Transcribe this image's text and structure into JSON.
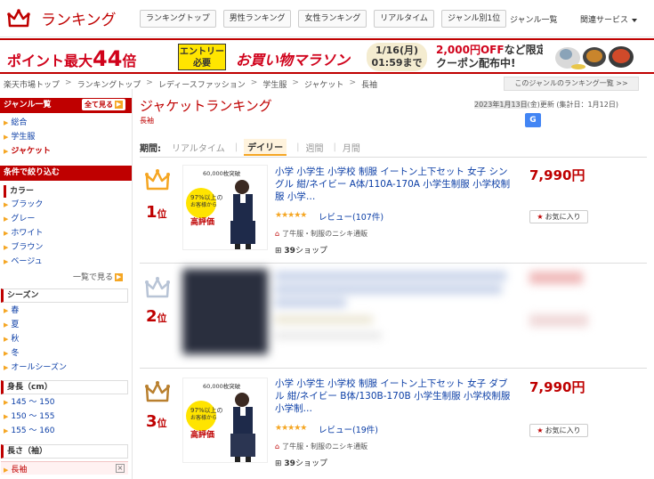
{
  "header": {
    "logo_text": "ランキング",
    "nav_tabs": [
      "ランキングトップ",
      "男性ランキング",
      "女性ランキング",
      "リアルタイム",
      "ジャンル別1位"
    ],
    "genre_list": "ジャンル一覧",
    "related_services": "関連サービス"
  },
  "banner": {
    "point_text": "ポイント最大",
    "point_num": "44",
    "point_unit": "倍",
    "entry_line1": "エントリー",
    "entry_line2": "必要",
    "marathon": "お買い物マラソン",
    "date_line1": "1/16(月)",
    "date_line2": "01:59まで",
    "coupon_line1a": "2,000円OFF",
    "coupon_line1b": "など限定",
    "coupon_line2": "クーポン配布中!"
  },
  "breadcrumb": [
    "楽天市場トップ",
    "ランキングトップ",
    "レディースファッション",
    "学生服",
    "ジャケット",
    "長袖"
  ],
  "other_genre_link": "このジャンルのランキング一覧 >>",
  "sidebar": {
    "genre_header": "ジャンル一覧",
    "see_all": "全て見る",
    "genres": [
      {
        "label": "総合",
        "current": false
      },
      {
        "label": "学生服",
        "current": false
      },
      {
        "label": "ジャケット",
        "current": true
      }
    ],
    "filter_header": "条件で絞り込む",
    "color_title": "カラー",
    "colors": [
      "ブラック",
      "グレー",
      "ホワイト",
      "ブラウン",
      "ベージュ"
    ],
    "more_link": "一覧で見る",
    "season_title": "シーズン",
    "seasons": [
      "春",
      "夏",
      "秋",
      "冬",
      "オールシーズン"
    ],
    "height_title": "身長（cm）",
    "heights": [
      "145 ～ 150",
      "150 ～ 155",
      "155 ～ 160"
    ],
    "length_title": "長さ（袖）",
    "length_selected": "長袖"
  },
  "main": {
    "title": "ジャケットランキング",
    "subtitle": "長袖",
    "updated_date": "2023年1月13日",
    "updated_rest": "(金)更新 (集計日：1月12日)",
    "period_label": "期間:",
    "periods": [
      {
        "label": "リアルタイム",
        "current": false
      },
      {
        "label": "デイリー",
        "current": true
      },
      {
        "label": "週間",
        "current": false
      },
      {
        "label": "月間",
        "current": false
      }
    ]
  },
  "items": [
    {
      "rank": "1",
      "rank_suffix": "位",
      "title": "小学 小学生 小学校 制服 イートン上下セット 女子 シングル 紺/ネイビー A体/110A-170A 小学生制服 小学校制服 小学…",
      "price": "7,990円",
      "stars": "★★★★★",
      "review": "レビュー(107件)",
      "shop": "了牛服・制服のニシキ通販",
      "shops_count": "39",
      "shops_suffix": "ショップ",
      "fav": "お気に入り",
      "thumb_text1": "60,000枚突破",
      "thumb_text2": "97%以上の",
      "thumb_text3": "お客様から",
      "thumb_text4": "高評価"
    },
    {
      "rank": "2",
      "rank_suffix": "位",
      "title": "",
      "price": ""
    },
    {
      "rank": "3",
      "rank_suffix": "位",
      "title": "小学 小学生 小学校 制服 イートン上下セット 女子 ダブル 紺/ネイビー B体/130B-170B 小学生制服 小学校制服 小学制…",
      "price": "7,990円",
      "stars": "★★★★★",
      "review": "レビュー(19件)",
      "shop": "了牛服・制服のニシキ通販",
      "shops_count": "39",
      "shops_suffix": "ショップ",
      "fav": "お気に入り",
      "thumb_text1": "60,000枚突破",
      "thumb_text2": "97%以上の",
      "thumb_text3": "お客様から",
      "thumb_text4": "高評価"
    }
  ],
  "colors": {
    "brand": "#bf0000",
    "link": "#0b3ea6",
    "gold": "#f5a623",
    "silver": "#b8c4d6",
    "bronze": "#b9802f"
  }
}
